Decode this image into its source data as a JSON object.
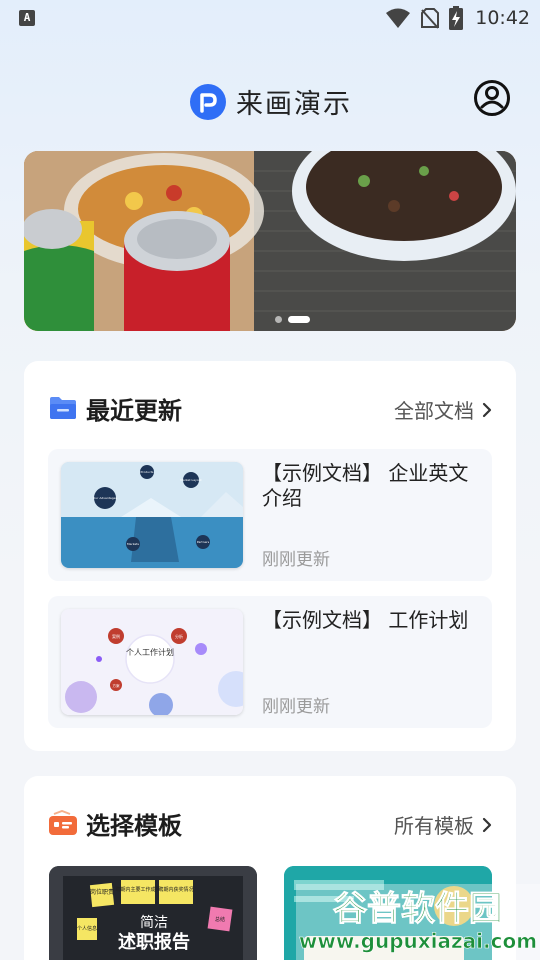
{
  "status_bar": {
    "notification_icon": "A",
    "time": "10:42",
    "icons": [
      "wifi-icon",
      "no-sim-icon",
      "battery-charging-icon"
    ]
  },
  "header": {
    "app_title": "来画演示",
    "logo_icon": "app-logo-icon",
    "profile_icon": "profile-icon"
  },
  "banner": {
    "slide_count": 2,
    "active_slide": 2
  },
  "recent": {
    "title": "最近更新",
    "link_label": "全部文档",
    "items": [
      {
        "title": "【示例文档】 企业英文介绍",
        "subtitle": "刚刚更新",
        "thumb_labels": [
          "Our Advantages",
          "Products",
          "Market Layout",
          "Partners",
          "Markets"
        ]
      },
      {
        "title": "【示例文档】 工作计划",
        "subtitle": "刚刚更新",
        "thumb_title": "个人工作计划",
        "thumb_labels": [
          "案例",
          "分析",
          "方案"
        ]
      }
    ]
  },
  "templates": {
    "title": "选择模板",
    "link_label": "所有模板",
    "items": [
      {
        "heading_small": "简洁",
        "heading_big": "述职报告",
        "notes": [
          "岗位职责",
          "聘期内主要工作成果",
          "聘期内获奖情况",
          "个人信息",
          "总结"
        ]
      },
      {
        "heading_small": "",
        "heading_big": ""
      }
    ]
  },
  "watermark": {
    "title": "谷普软件园",
    "url": "www.gupuxiazai.com"
  },
  "colors": {
    "brand": "#2f6ef6",
    "card": "#ffffff",
    "item_bg": "#f5f7fb",
    "muted_text": "#9a9a9a"
  }
}
